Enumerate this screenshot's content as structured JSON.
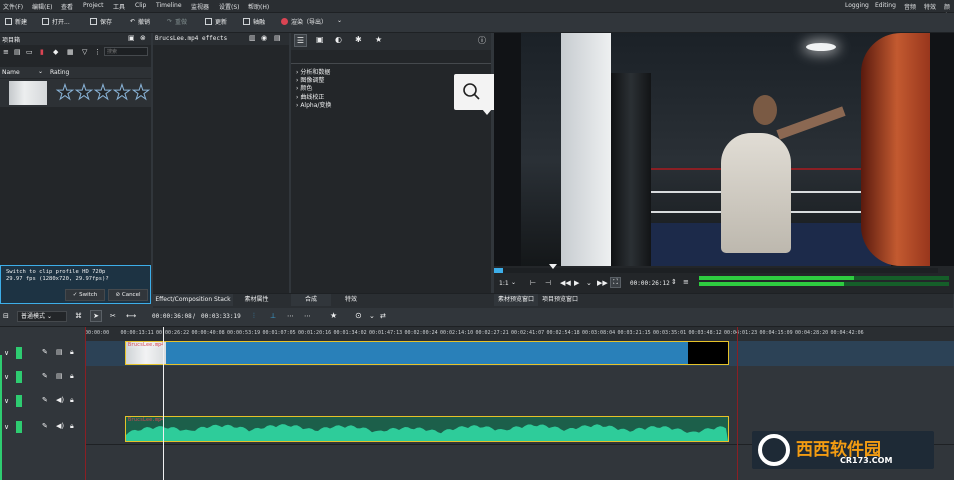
{
  "menubar": {
    "items": [
      "文件(F)",
      "编辑(E)",
      "查看",
      "Project",
      "工具",
      "Clip",
      "Timeline",
      "监视器",
      "设置(S)",
      "帮助(H)"
    ],
    "workspaces": [
      "Logging",
      "Editing",
      "音频",
      "特效",
      "颜色"
    ]
  },
  "toolbar": {
    "new_label": "新建",
    "open_label": "打开...",
    "save_label": "保存",
    "undo_label": "撤销",
    "redo_label": "重做",
    "render_label": "渲染（导出）",
    "record_color": "#da4453",
    "project_label": "更新",
    "render2_label": "轴融"
  },
  "bin": {
    "title": "项目箱",
    "search_placeholder": "搜索",
    "col_name": "Name",
    "col_rating": "Rating",
    "rating": 0,
    "rating_max": 5
  },
  "notification": {
    "text": "Switch to clip profile HD 720p 29.97 fps (1280x720, 29.97fps)?",
    "switch_label": "Switch",
    "cancel_label": "Cancel"
  },
  "effect_stack": {
    "title": "BrucsLee.mp4 effects"
  },
  "effects_tree": {
    "items": [
      "分析和数据",
      "图像调整",
      "颜色",
      "曲线校正",
      "Alpha/变换"
    ]
  },
  "tabs_left": [
    "Effect/Composition Stack",
    "素材属性",
    "合成",
    "特效"
  ],
  "tabs_right": [
    "素材预览窗口",
    "项目预览窗口"
  ],
  "monitor": {
    "zoom": "1:1",
    "timecode": "00:00:26:12",
    "search_tooltip_icon": "search-icon",
    "comment_tooltip_icon": "comment-icon",
    "clip_progress": 0.02
  },
  "timeline_toolbar": {
    "mode_label": "普通模式",
    "position": "00:00:36:08",
    "duration": "00:03:33:19"
  },
  "ruler": [
    "00:00:00",
    "00:00:13:11",
    "00:00:26:22",
    "00:00:40:08",
    "00:00:53:19",
    "00:01:07:05",
    "00:01:20:16",
    "00:01:34:02",
    "00:01:47:13",
    "00:02:00:24",
    "00:02:14:10",
    "00:02:27:21",
    "00:02:41:07",
    "00:02:54:18",
    "00:03:08:04",
    "00:03:21:15",
    "00:03:35:01",
    "00:03:48:12",
    "00:04:01:23",
    "00:04:15:09",
    "00:04:28:20",
    "00:04:42:06"
  ],
  "clips": {
    "video_label": "BrucsLee.mp4",
    "audio_label": "BrucsLee.mp4",
    "video_color": "#2980b9",
    "audio_color": "#1f9d70"
  },
  "watermark": {
    "brand": "西西软件园",
    "url": "CR173.COM"
  }
}
